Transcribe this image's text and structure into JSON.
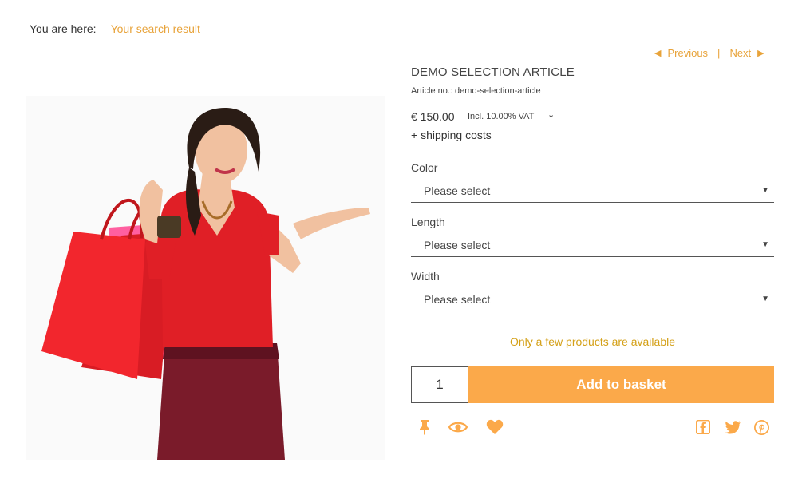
{
  "breadcrumb": {
    "label": "You are here:",
    "current": "Your search result"
  },
  "pager": {
    "previous": "Previous",
    "separator": "|",
    "next": "Next"
  },
  "product": {
    "title": "DEMO SELECTION ARTICLE",
    "article_no": "Article no.: demo-selection-article",
    "price": "€ 150.00",
    "vat": "Incl. 10.00% VAT",
    "shipping": "+ shipping costs",
    "availability": "Only a few products are available"
  },
  "options": [
    {
      "label": "Color",
      "value": "Please select"
    },
    {
      "label": "Length",
      "value": "Please select"
    },
    {
      "label": "Width",
      "value": "Please select"
    }
  ],
  "basket": {
    "quantity": "1",
    "button_label": "Add to basket"
  },
  "colors": {
    "accent": "#fba94a",
    "link": "#e8a33a",
    "availability": "#d4a017",
    "dress": "#e01f26",
    "bag": "#e8202a",
    "skirt": "#7a1b2a"
  },
  "icons": [
    "pin-icon",
    "eye-icon",
    "heart-icon",
    "facebook-icon",
    "twitter-icon",
    "pinterest-icon"
  ]
}
